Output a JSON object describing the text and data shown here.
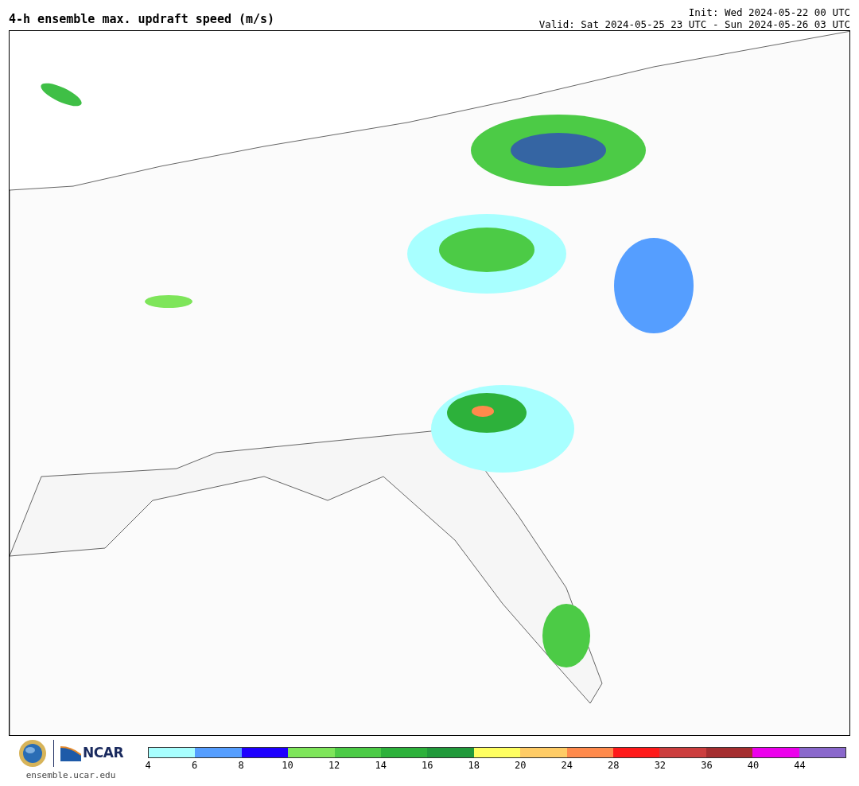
{
  "header": {
    "title": "4-h ensemble max. updraft speed (m/s)",
    "init": "Init: Wed 2024-05-22 00 UTC",
    "valid": "Valid: Sat 2024-05-25 23 UTC - Sun 2024-05-26 03 UTC"
  },
  "footer": {
    "logo_text": "NCAR",
    "url": "ensemble.ucar.edu"
  },
  "colorbar": {
    "bins": [
      {
        "color": "#a8ffff"
      },
      {
        "color": "#559eff"
      },
      {
        "color": "#1e00ff"
      },
      {
        "color": "#7ee55a"
      },
      {
        "color": "#4ccb46"
      },
      {
        "color": "#2db13b"
      },
      {
        "color": "#219a3b"
      },
      {
        "color": "#ffff60"
      },
      {
        "color": "#ffcc66"
      },
      {
        "color": "#ff8a4c"
      },
      {
        "color": "#ff1a1a"
      },
      {
        "color": "#cc3e3e"
      },
      {
        "color": "#a52e30"
      },
      {
        "color": "#ec00ec"
      },
      {
        "color": "#8a68cc"
      }
    ],
    "ticks": [
      "4",
      "6",
      "8",
      "10",
      "12",
      "14",
      "16",
      "18",
      "20",
      "24",
      "28",
      "32",
      "36",
      "40",
      "44"
    ]
  }
}
